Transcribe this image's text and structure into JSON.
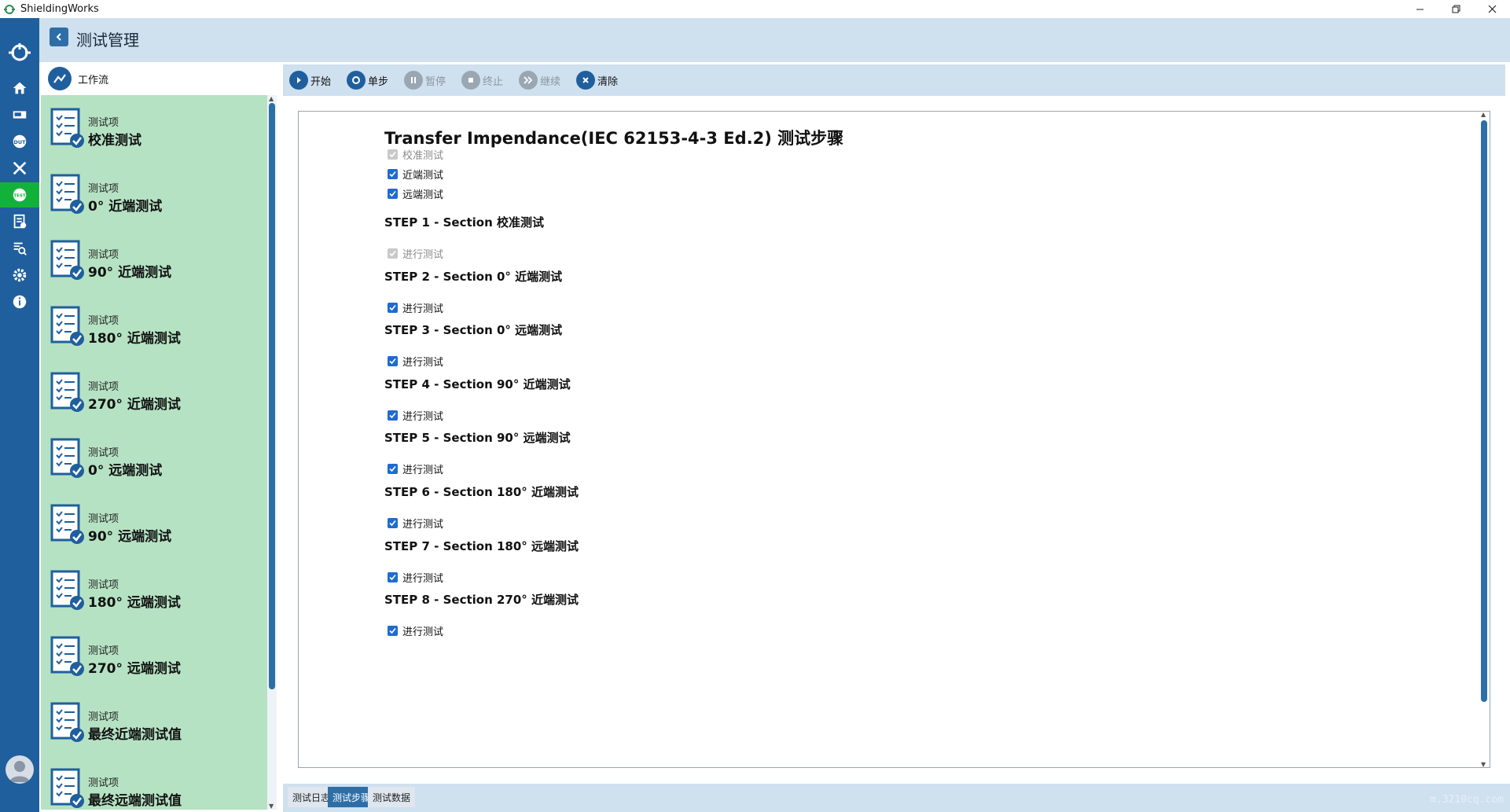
{
  "window": {
    "title": "ShieldingWorks"
  },
  "header": {
    "title": "测试管理"
  },
  "workflow": {
    "label": "工作流",
    "items": [
      {
        "sub": "测试项",
        "name": "校准测试"
      },
      {
        "sub": "测试项",
        "name": "0° 近端测试"
      },
      {
        "sub": "测试项",
        "name": "90° 近端测试"
      },
      {
        "sub": "测试项",
        "name": "180° 近端测试"
      },
      {
        "sub": "测试项",
        "name": "270° 近端测试"
      },
      {
        "sub": "测试项",
        "name": "0° 远端测试"
      },
      {
        "sub": "测试项",
        "name": "90° 远端测试"
      },
      {
        "sub": "测试项",
        "name": "180° 远端测试"
      },
      {
        "sub": "测试项",
        "name": "270° 远端测试"
      },
      {
        "sub": "测试项",
        "name": "最终近端测试值"
      },
      {
        "sub": "测试项",
        "name": "最终远端测试值"
      }
    ]
  },
  "toolbar": {
    "start": "开始",
    "step": "单步",
    "pause": "暂停",
    "stop": "终止",
    "resume": "继续",
    "clear": "清除"
  },
  "steps": {
    "title": "Transfer Impendance(IEC 62153-4-3 Ed.2) 测试步骤",
    "top_checks": [
      {
        "label": "校准测试",
        "state": "disabled"
      },
      {
        "label": "近端测试",
        "state": "checked"
      },
      {
        "label": "远端测试",
        "state": "checked"
      }
    ],
    "sections": [
      {
        "head": "STEP 1 - Section 校准测试",
        "check": "进行测试",
        "state": "disabled"
      },
      {
        "head": "STEP 2 - Section 0° 近端测试",
        "check": "进行测试",
        "state": "checked"
      },
      {
        "head": "STEP 3 - Section 0° 远端测试",
        "check": "进行测试",
        "state": "checked"
      },
      {
        "head": "STEP 4 - Section 90° 近端测试",
        "check": "进行测试",
        "state": "checked"
      },
      {
        "head": "STEP 5 - Section 90° 远端测试",
        "check": "进行测试",
        "state": "checked"
      },
      {
        "head": "STEP 6 - Section 180° 近端测试",
        "check": "进行测试",
        "state": "checked"
      },
      {
        "head": "STEP 7 - Section 180° 远端测试",
        "check": "进行测试",
        "state": "checked"
      },
      {
        "head": "STEP 8 - Section 270° 近端测试",
        "check": "进行测试",
        "state": "checked"
      }
    ]
  },
  "tabs": [
    {
      "label": "测试日志",
      "active": false
    },
    {
      "label": "测试步骤",
      "active": true
    },
    {
      "label": "测试数据",
      "active": false
    }
  ],
  "watermark": "m.3210cq.com",
  "icons": {
    "rail": [
      "home-icon",
      "monitor-icon",
      "dut-icon",
      "tools-icon",
      "test-icon",
      "report-icon",
      "search-doc-icon",
      "settings-icon",
      "info-icon"
    ]
  },
  "colors": {
    "rail": "#1f5f9e",
    "accent": "#2e6ea6",
    "active_green": "#12b23a",
    "workflow_bg": "#b5e2c3",
    "header_bg": "#cfe0ef"
  }
}
